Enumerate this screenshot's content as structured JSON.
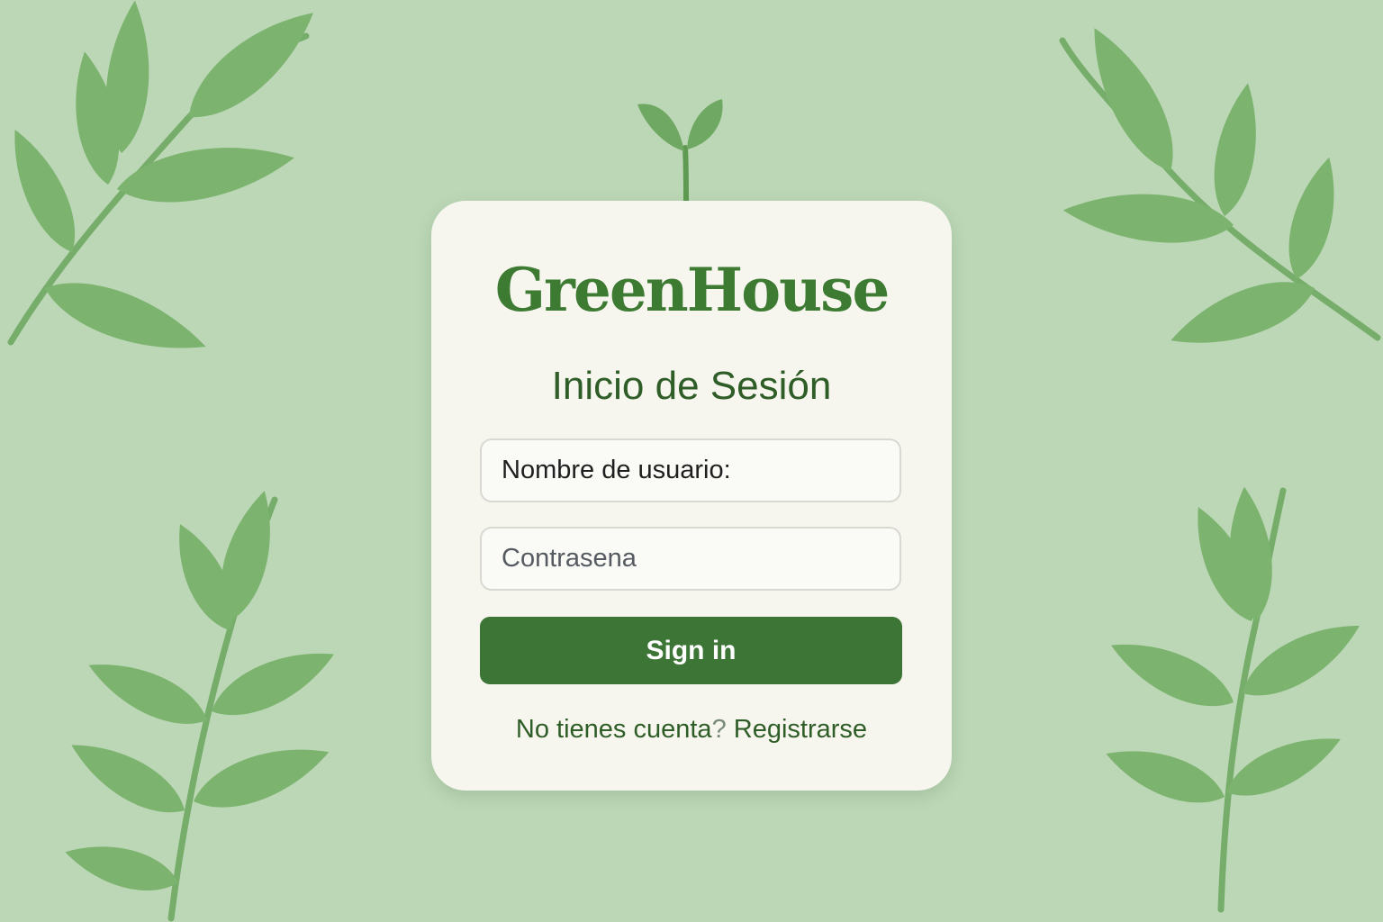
{
  "app": {
    "brand": "GreenHouse"
  },
  "login": {
    "title": "Inicio de Sesión",
    "username_placeholder": "Nombre de usuario:",
    "password_placeholder": "Contrasena",
    "signin_label": "Sign in",
    "register_prompt": "No tienes cuenta",
    "register_question_mark": "?",
    "register_link": "Registrarse"
  },
  "colors": {
    "background": "#bcd7b6",
    "card": "#f6f6ee",
    "brand_text": "#3d7a32",
    "accent_button": "#3d7537",
    "leaf": "#7cb36f"
  },
  "icons": {
    "sprout": "sprout-icon",
    "leaves": "leaf-branch-icon"
  }
}
